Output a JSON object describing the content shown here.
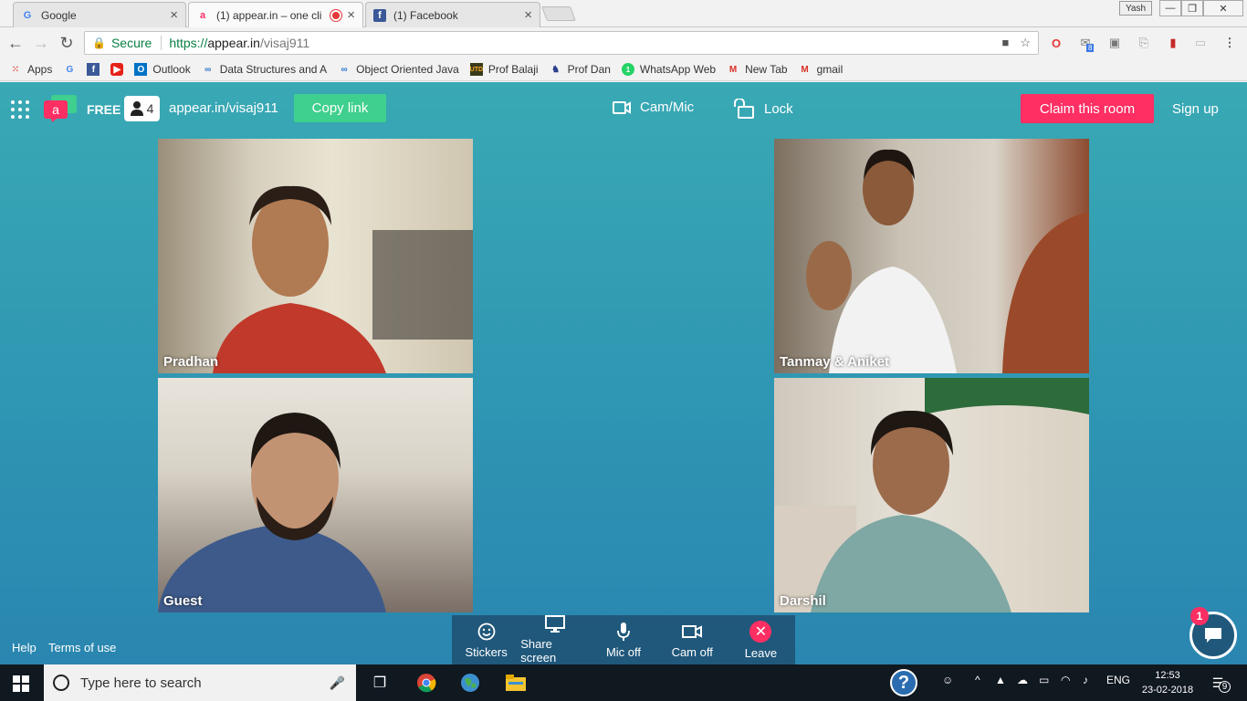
{
  "browser": {
    "tabs": [
      {
        "title": "Google"
      },
      {
        "title": "(1) appear.in – one cli"
      },
      {
        "title": "(1) Facebook"
      }
    ],
    "profile_name": "Yash",
    "secure_label": "Secure",
    "url": {
      "scheme": "https://",
      "host": "appear.in",
      "path": "/visaj911"
    },
    "extension_badge": "8",
    "bookmarks": [
      {
        "label": "Apps"
      },
      {
        "label": ""
      },
      {
        "label": ""
      },
      {
        "label": ""
      },
      {
        "label": "Outlook"
      },
      {
        "label": "Data Structures and A"
      },
      {
        "label": "Object Oriented Java"
      },
      {
        "label": "Prof Balaji"
      },
      {
        "label": "Prof Dan"
      },
      {
        "label": "WhatsApp Web"
      },
      {
        "label": "New Tab"
      },
      {
        "label": "gmail"
      }
    ]
  },
  "app": {
    "plan_label": "FREE",
    "participant_count": "4",
    "room_name": "appear.in/visaj911",
    "copy_link_label": "Copy link",
    "cam_mic_label": "Cam/Mic",
    "lock_label": "Lock",
    "claim_label": "Claim this room",
    "signup_label": "Sign up",
    "participants": [
      {
        "name": "Pradhan"
      },
      {
        "name": "Tanmay & Aniket"
      },
      {
        "name": "Guest"
      },
      {
        "name": "Darshil"
      }
    ],
    "footer": {
      "help": "Help",
      "terms": "Terms of use"
    },
    "controls": [
      {
        "label": "Stickers"
      },
      {
        "label": "Share screen"
      },
      {
        "label": "Mic off"
      },
      {
        "label": "Cam off"
      },
      {
        "label": "Leave"
      }
    ],
    "chat_badge": "1",
    "colors": {
      "accent_pink": "#ff2e63",
      "copy_green": "#3fcf8e",
      "control_bar": "#20587b"
    }
  },
  "taskbar": {
    "search_placeholder": "Type here to search",
    "language": "ENG",
    "time": "12:53",
    "date": "23-02-2018",
    "notification_count": "9"
  }
}
